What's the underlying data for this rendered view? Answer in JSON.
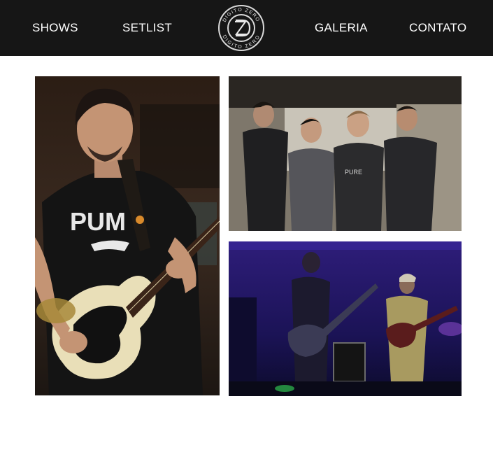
{
  "nav": {
    "left": [
      {
        "label": "SHOWS"
      },
      {
        "label": "SETLIST"
      }
    ],
    "right": [
      {
        "label": "GALERIA"
      },
      {
        "label": "CONTATO"
      }
    ],
    "logo": {
      "text_top": "DIGITO ZERO",
      "text_bottom": "DIGITO ZERO"
    }
  },
  "gallery": {
    "photos": [
      {
        "subject": "bassist-photo"
      },
      {
        "subject": "band-group-photo"
      },
      {
        "subject": "band-on-stage-photo"
      }
    ]
  },
  "colors": {
    "header_bg": "#161616",
    "nav_text": "#ffffff",
    "page_bg": "#ffffff"
  }
}
